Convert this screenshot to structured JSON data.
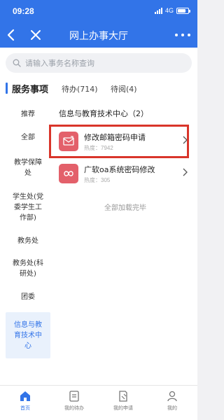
{
  "status_bar": {
    "time": "09:28",
    "network": "4G"
  },
  "nav": {
    "title": "网上办事大厅"
  },
  "search": {
    "placeholder": "请输入事务名称查询"
  },
  "tabs": [
    {
      "label": "服务事项",
      "active": true
    },
    {
      "label": "待办(714)",
      "active": false
    },
    {
      "label": "待阅(4)",
      "active": false
    }
  ],
  "sidebar": {
    "items": [
      {
        "label": "推荐"
      },
      {
        "label": "全部"
      },
      {
        "label": "教学保障\n处"
      },
      {
        "label": "学生处(党\n委学生工\n作部)"
      },
      {
        "label": "教务处"
      },
      {
        "label": "教务处(科\n研处)"
      },
      {
        "label": "团委"
      },
      {
        "label": "信息与教\n育技术中\n心",
        "active": true
      }
    ]
  },
  "main": {
    "group_title": "信息与教育技术中心（2）",
    "services": [
      {
        "name": "修改邮箱密码申请",
        "heat": "热度：7942",
        "icon": "email-password-icon",
        "highlighted": true
      },
      {
        "name": "广软oa系统密码修改",
        "heat": "热度：305",
        "icon": "oa-password-icon",
        "highlighted": false
      }
    ],
    "all_loaded": "全部加载完毕"
  },
  "tabbar": {
    "items": [
      {
        "label": "首页",
        "icon": "home-icon",
        "active": true
      },
      {
        "label": "我的待办",
        "icon": "todo-icon",
        "active": false
      },
      {
        "label": "我的申请",
        "icon": "application-icon",
        "active": false
      },
      {
        "label": "我的",
        "icon": "profile-icon",
        "active": false
      }
    ]
  },
  "colors": {
    "primary": "#3274e8",
    "service_icon_bg": "#e3606a",
    "highlight_border": "#d9352a"
  }
}
